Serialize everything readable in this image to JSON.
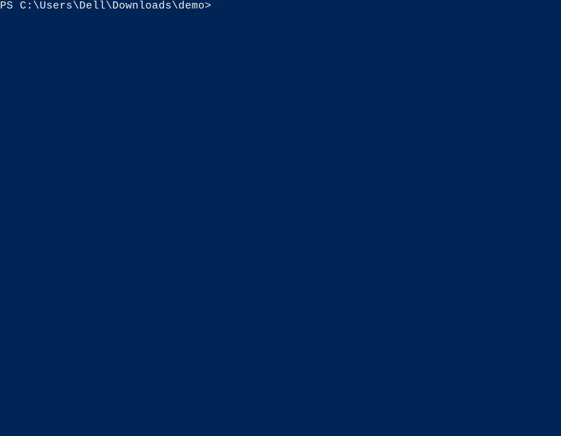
{
  "terminal": {
    "prompt": "PS C:\\Users\\Dell\\Downloads\\demo>",
    "command": ""
  }
}
